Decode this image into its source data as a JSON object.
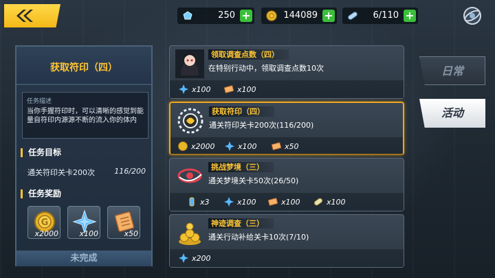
{
  "topbar": {
    "resources": [
      {
        "name": "stamina",
        "icon": "crystal-icon",
        "value": "250"
      },
      {
        "name": "coins",
        "icon": "coin-icon",
        "value": "144089"
      },
      {
        "name": "capacity",
        "icon": "capsule-icon",
        "value": "6/110"
      }
    ]
  },
  "detail": {
    "title": "获取符印（四）",
    "desc_label": "任务描述",
    "desc_text": "当你手握符印时，可以清晰的感觉到能量自符印内源源不断的流入你的体内",
    "goal_heading": "任务目标",
    "goal_text": "通关符印关卡200次",
    "goal_progress": "116/200",
    "reward_heading": "任务奖励",
    "rewards": [
      {
        "icon": "gold-coin-icon",
        "qty": "x2000"
      },
      {
        "icon": "blue-crystal-icon",
        "qty": "x100"
      },
      {
        "icon": "scroll-icon",
        "qty": "x50"
      }
    ],
    "status": "未完成"
  },
  "quests": [
    {
      "name": "领取调查点数（四）",
      "desc": "在特别行动中，领取调查点数10次",
      "rewards": [
        {
          "icon": "blue-crystal-icon",
          "qty": "x100"
        },
        {
          "icon": "scroll-icon",
          "qty": "x100"
        }
      ]
    },
    {
      "name": "获取符印（四）",
      "desc": "通关符印关卡200次(116/200)",
      "rewards": [
        {
          "icon": "gold-coin-icon",
          "qty": "x2000"
        },
        {
          "icon": "blue-crystal-icon",
          "qty": "x100"
        },
        {
          "icon": "scroll-icon",
          "qty": "x50"
        }
      ]
    },
    {
      "name": "挑战梦境（三）",
      "desc": "通关梦境关卡50次(26/50)",
      "rewards": [
        {
          "icon": "potion-icon",
          "qty": "x3"
        },
        {
          "icon": "blue-crystal-icon",
          "qty": "x100"
        },
        {
          "icon": "scroll-icon",
          "qty": "x100"
        },
        {
          "icon": "capsule-icon",
          "qty": "x100"
        }
      ]
    },
    {
      "name": "神迹调查（三）",
      "desc": "通关行动补给关卡10次(7/10)",
      "rewards": [
        {
          "icon": "blue-crystal-icon",
          "qty": "x200"
        }
      ]
    }
  ],
  "tabs": {
    "daily": "日常",
    "event": "活动"
  },
  "colors": {
    "accent_gold": "#ffc533",
    "active_border": "#f0a81f",
    "plus_green": "#3bbf3b"
  }
}
